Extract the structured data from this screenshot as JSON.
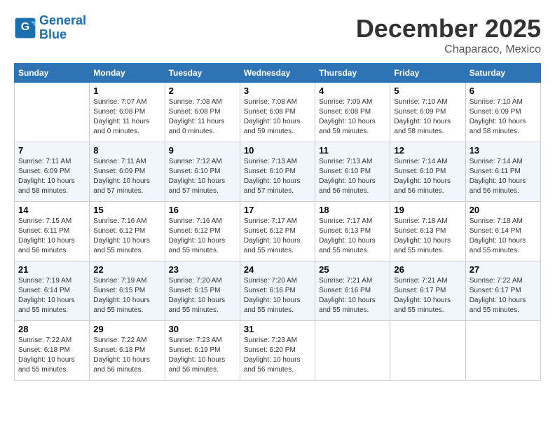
{
  "header": {
    "logo_line1": "General",
    "logo_line2": "Blue",
    "month": "December 2025",
    "location": "Chaparaco, Mexico"
  },
  "days_of_week": [
    "Sunday",
    "Monday",
    "Tuesday",
    "Wednesday",
    "Thursday",
    "Friday",
    "Saturday"
  ],
  "weeks": [
    [
      {
        "day": "",
        "info": ""
      },
      {
        "day": "1",
        "info": "Sunrise: 7:07 AM\nSunset: 6:08 PM\nDaylight: 11 hours\nand 0 minutes."
      },
      {
        "day": "2",
        "info": "Sunrise: 7:08 AM\nSunset: 6:08 PM\nDaylight: 11 hours\nand 0 minutes."
      },
      {
        "day": "3",
        "info": "Sunrise: 7:08 AM\nSunset: 6:08 PM\nDaylight: 10 hours\nand 59 minutes."
      },
      {
        "day": "4",
        "info": "Sunrise: 7:09 AM\nSunset: 6:08 PM\nDaylight: 10 hours\nand 59 minutes."
      },
      {
        "day": "5",
        "info": "Sunrise: 7:10 AM\nSunset: 6:09 PM\nDaylight: 10 hours\nand 58 minutes."
      },
      {
        "day": "6",
        "info": "Sunrise: 7:10 AM\nSunset: 6:09 PM\nDaylight: 10 hours\nand 58 minutes."
      }
    ],
    [
      {
        "day": "7",
        "info": "Sunrise: 7:11 AM\nSunset: 6:09 PM\nDaylight: 10 hours\nand 58 minutes."
      },
      {
        "day": "8",
        "info": "Sunrise: 7:11 AM\nSunset: 6:09 PM\nDaylight: 10 hours\nand 57 minutes."
      },
      {
        "day": "9",
        "info": "Sunrise: 7:12 AM\nSunset: 6:10 PM\nDaylight: 10 hours\nand 57 minutes."
      },
      {
        "day": "10",
        "info": "Sunrise: 7:13 AM\nSunset: 6:10 PM\nDaylight: 10 hours\nand 57 minutes."
      },
      {
        "day": "11",
        "info": "Sunrise: 7:13 AM\nSunset: 6:10 PM\nDaylight: 10 hours\nand 56 minutes."
      },
      {
        "day": "12",
        "info": "Sunrise: 7:14 AM\nSunset: 6:10 PM\nDaylight: 10 hours\nand 56 minutes."
      },
      {
        "day": "13",
        "info": "Sunrise: 7:14 AM\nSunset: 6:11 PM\nDaylight: 10 hours\nand 56 minutes."
      }
    ],
    [
      {
        "day": "14",
        "info": "Sunrise: 7:15 AM\nSunset: 6:11 PM\nDaylight: 10 hours\nand 56 minutes."
      },
      {
        "day": "15",
        "info": "Sunrise: 7:16 AM\nSunset: 6:12 PM\nDaylight: 10 hours\nand 55 minutes."
      },
      {
        "day": "16",
        "info": "Sunrise: 7:16 AM\nSunset: 6:12 PM\nDaylight: 10 hours\nand 55 minutes."
      },
      {
        "day": "17",
        "info": "Sunrise: 7:17 AM\nSunset: 6:12 PM\nDaylight: 10 hours\nand 55 minutes."
      },
      {
        "day": "18",
        "info": "Sunrise: 7:17 AM\nSunset: 6:13 PM\nDaylight: 10 hours\nand 55 minutes."
      },
      {
        "day": "19",
        "info": "Sunrise: 7:18 AM\nSunset: 6:13 PM\nDaylight: 10 hours\nand 55 minutes."
      },
      {
        "day": "20",
        "info": "Sunrise: 7:18 AM\nSunset: 6:14 PM\nDaylight: 10 hours\nand 55 minutes."
      }
    ],
    [
      {
        "day": "21",
        "info": "Sunrise: 7:19 AM\nSunset: 6:14 PM\nDaylight: 10 hours\nand 55 minutes."
      },
      {
        "day": "22",
        "info": "Sunrise: 7:19 AM\nSunset: 6:15 PM\nDaylight: 10 hours\nand 55 minutes."
      },
      {
        "day": "23",
        "info": "Sunrise: 7:20 AM\nSunset: 6:15 PM\nDaylight: 10 hours\nand 55 minutes."
      },
      {
        "day": "24",
        "info": "Sunrise: 7:20 AM\nSunset: 6:16 PM\nDaylight: 10 hours\nand 55 minutes."
      },
      {
        "day": "25",
        "info": "Sunrise: 7:21 AM\nSunset: 6:16 PM\nDaylight: 10 hours\nand 55 minutes."
      },
      {
        "day": "26",
        "info": "Sunrise: 7:21 AM\nSunset: 6:17 PM\nDaylight: 10 hours\nand 55 minutes."
      },
      {
        "day": "27",
        "info": "Sunrise: 7:22 AM\nSunset: 6:17 PM\nDaylight: 10 hours\nand 55 minutes."
      }
    ],
    [
      {
        "day": "28",
        "info": "Sunrise: 7:22 AM\nSunset: 6:18 PM\nDaylight: 10 hours\nand 55 minutes."
      },
      {
        "day": "29",
        "info": "Sunrise: 7:22 AM\nSunset: 6:18 PM\nDaylight: 10 hours\nand 56 minutes."
      },
      {
        "day": "30",
        "info": "Sunrise: 7:23 AM\nSunset: 6:19 PM\nDaylight: 10 hours\nand 56 minutes."
      },
      {
        "day": "31",
        "info": "Sunrise: 7:23 AM\nSunset: 6:20 PM\nDaylight: 10 hours\nand 56 minutes."
      },
      {
        "day": "",
        "info": ""
      },
      {
        "day": "",
        "info": ""
      },
      {
        "day": "",
        "info": ""
      }
    ]
  ]
}
